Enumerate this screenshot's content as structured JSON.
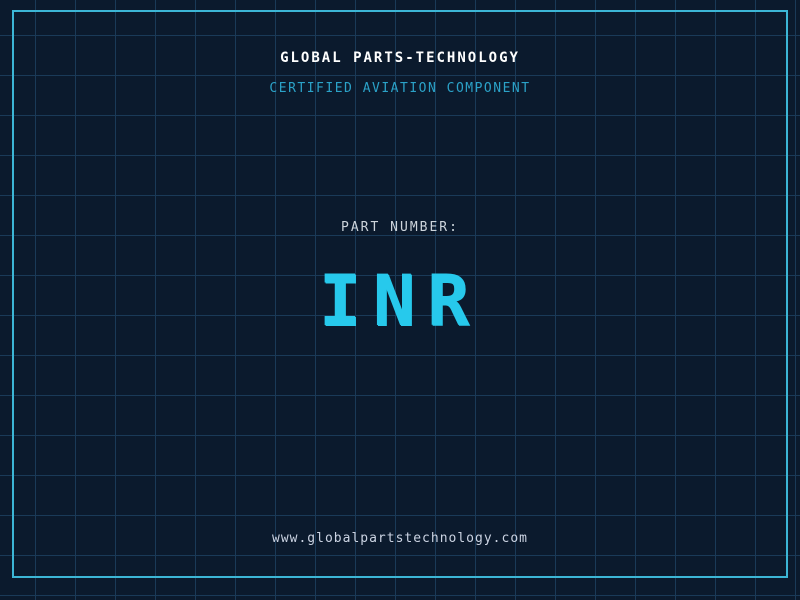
{
  "header": {
    "company": "GLOBAL PARTS-TECHNOLOGY",
    "subtitle": "CERTIFIED AVIATION COMPONENT"
  },
  "part": {
    "label": "PART NUMBER:",
    "number": "INR"
  },
  "footer": {
    "website": "www.globalpartstechnology.com"
  },
  "colors": {
    "background": "#0b1a2d",
    "grid_line": "#1a3a58",
    "frame_border": "#3cb6d6",
    "accent_cyan": "#27c9ec",
    "subtitle_blue": "#2ba2c8",
    "text_white": "#ffffff"
  }
}
